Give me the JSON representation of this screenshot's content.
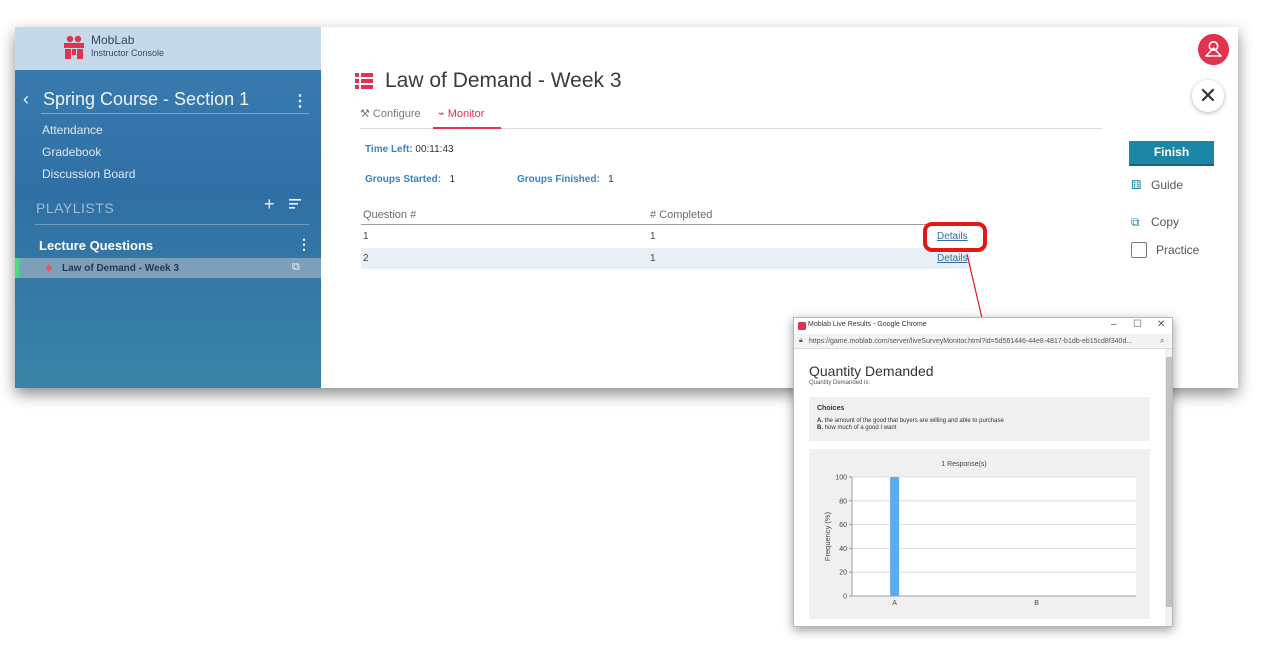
{
  "brand": {
    "name": "MobLab",
    "subtitle": "Instructor Console"
  },
  "sidebar": {
    "course_title": "Spring Course - Section 1",
    "back_glyph": "‹",
    "menu_glyph": "⋮",
    "nav": [
      {
        "label": "Attendance"
      },
      {
        "label": "Gradebook"
      },
      {
        "label": "Discussion Board"
      }
    ],
    "playlists_label": "PLAYLISTS",
    "add_glyph": "+",
    "playlist_name": "Lecture Questions",
    "active_item": "Law of Demand - Week 3"
  },
  "page": {
    "title": "Law of Demand - Week 3",
    "tabs": [
      {
        "label": "Configure",
        "icon": "wrench-icon"
      },
      {
        "label": "Monitor",
        "icon": "pulse-icon",
        "active": true
      }
    ],
    "time_left_label": "Time Left:",
    "time_left_value": "00:11:43",
    "groups_started_label": "Groups Started:",
    "groups_started_value": "1",
    "groups_finished_label": "Groups Finished:",
    "groups_finished_value": "1",
    "table": {
      "headers": [
        "Question #",
        "# Completed"
      ],
      "rows": [
        {
          "question": "1",
          "completed": "1",
          "link": "Details"
        },
        {
          "question": "2",
          "completed": "1",
          "link": "Details"
        }
      ]
    }
  },
  "actions": {
    "finish": "Finish",
    "guide": "Guide",
    "copy": "Copy",
    "practice": "Practice",
    "close_glyph": "✕"
  },
  "popup": {
    "window_title": "Moblab Live Results - Google Chrome",
    "url": "https://game.moblab.com/server/liveSurveyMonitor.html?id=5d561446-44e8-4817-b1db-eb15cd8f340d...",
    "min_glyph": "–",
    "max_glyph": "☐",
    "close_glyph": "✕",
    "question_title": "Quantity Demanded",
    "question_sub": "Quantity Demanded is:",
    "choices_head": "Choices",
    "choices": [
      {
        "key": "A.",
        "text": "the amount of the good that buyers are willing and able to purchase"
      },
      {
        "key": "B.",
        "text": "how much of a good I want"
      }
    ]
  },
  "colors": {
    "accent": "#e0334f",
    "finish": "#1c86a6",
    "bar": "#5aabf0",
    "highlight": "#e01818"
  },
  "chart_data": {
    "type": "bar",
    "title": "1 Response(s)",
    "categories": [
      "A",
      "B"
    ],
    "values": [
      100,
      0
    ],
    "ylabel": "Frequency (%)",
    "xlabel": "",
    "ylim": [
      0,
      100
    ],
    "yticks": [
      0,
      20,
      40,
      60,
      80,
      100
    ],
    "grid": true
  }
}
